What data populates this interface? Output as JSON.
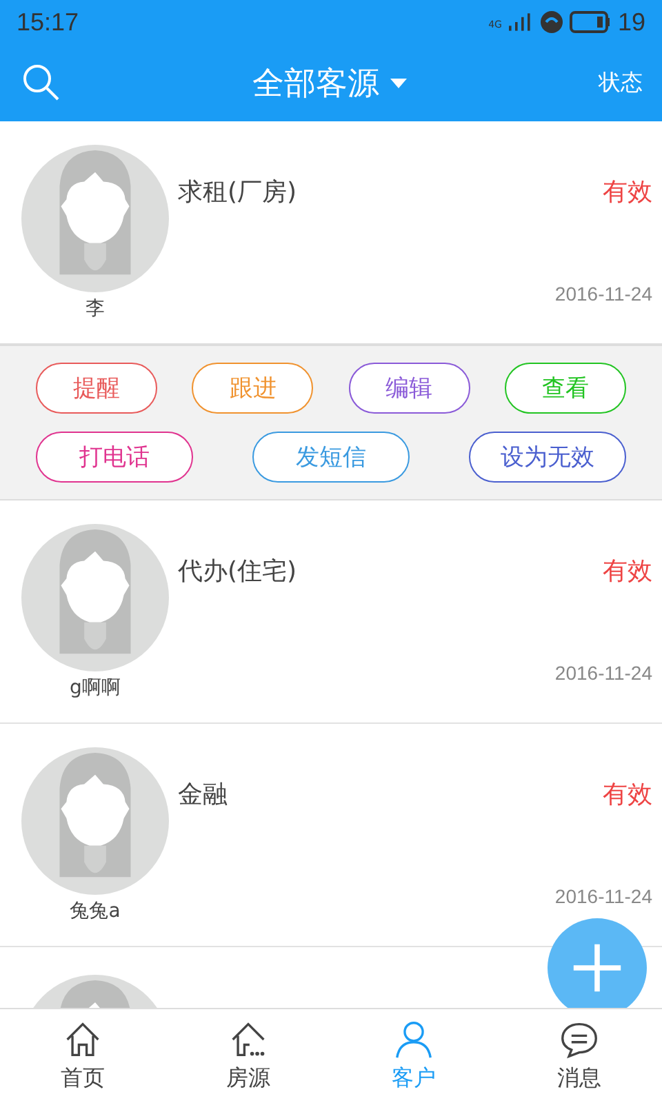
{
  "status_bar": {
    "time": "15:17",
    "network": "4G",
    "battery": "19"
  },
  "header": {
    "title": "全部客源",
    "action": "状态"
  },
  "customers": [
    {
      "title": "求租(厂房)",
      "status": "有效",
      "name": "李",
      "date": "2016-11-24",
      "expanded": true
    },
    {
      "title": "代办(住宅)",
      "status": "有效",
      "name": "g啊啊",
      "date": "2016-11-24",
      "expanded": false
    },
    {
      "title": "金融",
      "status": "有效",
      "name": "兔兔a",
      "date": "2016-11-24",
      "expanded": false
    }
  ],
  "partial_row": {
    "kind": "picture"
  },
  "actions": [
    [
      {
        "label": "提醒",
        "color": "#e85a5a"
      },
      {
        "label": "跟进",
        "color": "#f0922e"
      },
      {
        "label": "编辑",
        "color": "#8a5ad8"
      },
      {
        "label": "查看",
        "color": "#22c422"
      }
    ],
    [
      {
        "label": "打电话",
        "color": "#e0338f"
      },
      {
        "label": "发短信",
        "color": "#3a9ae0"
      },
      {
        "label": "设为无效",
        "color": "#4a5fcf"
      }
    ]
  ],
  "nav": [
    {
      "label": "首页",
      "kind": "home",
      "selected": false
    },
    {
      "label": "房源",
      "kind": "houses",
      "selected": false
    },
    {
      "label": "客户",
      "kind": "person",
      "selected": true
    },
    {
      "label": "消息",
      "kind": "chat",
      "selected": false
    }
  ]
}
